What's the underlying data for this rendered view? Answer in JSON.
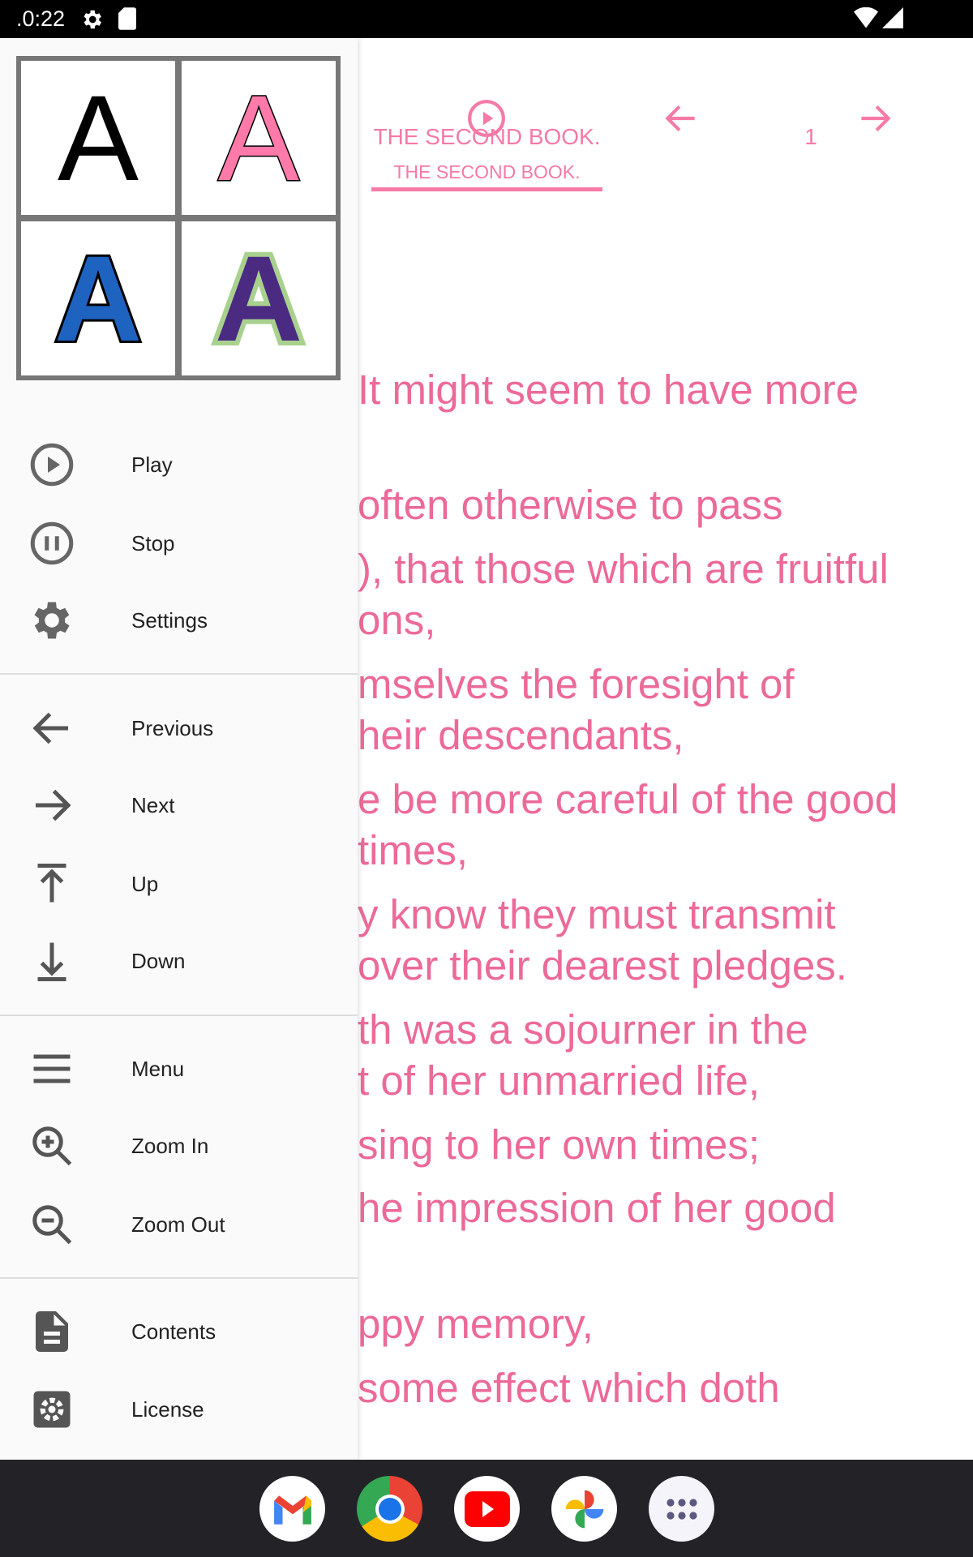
{
  "status_bar": {
    "time": ".0:22",
    "icons": [
      "settings-icon",
      "sd-card-icon",
      "wifi-icon",
      "signal-icon"
    ]
  },
  "header": {
    "tab_title": "THE SECOND BOOK.",
    "tab_subtitle": "THE SECOND BOOK.",
    "page_number": "1",
    "icons": [
      "play-circle-icon",
      "arrow-left-icon",
      "arrow-right-icon"
    ]
  },
  "accent_color": "#f57aa5",
  "text_color": "#ec6a98",
  "body_lines": [
    "It might seem to have more",
    " often otherwise to pass",
    "), that those which are fruitful",
    "ons,",
    "mselves the foresight of",
    "heir descendants,",
    "e be more careful of the good",
    " times,",
    "y know they must transmit",
    "over their dearest pledges.",
    "th was a sojourner in the",
    "t of her unmarried life,",
    "sing to her own times;",
    "he impression of her good",
    "ppy memory,",
    "some effect which doth"
  ],
  "font_tiles": [
    {
      "letter": "A",
      "fill": "#000000",
      "outline": "#000000"
    },
    {
      "letter": "A",
      "fill": "#ff7aa8",
      "outline": "#000000"
    },
    {
      "letter": "A",
      "fill": "#1e63c0",
      "outline": "#000000"
    },
    {
      "letter": "A",
      "fill": "#4b2a82",
      "outline": "#a9d18e"
    }
  ],
  "drawer": {
    "items": [
      {
        "label": "Play",
        "icon": "play-circle-icon"
      },
      {
        "label": "Stop",
        "icon": "pause-circle-icon"
      },
      {
        "label": "Settings",
        "icon": "gear-icon"
      },
      {
        "label": "Previous",
        "icon": "arrow-left-icon"
      },
      {
        "label": "Next",
        "icon": "arrow-right-icon"
      },
      {
        "label": "Up",
        "icon": "arrow-up-to-top-icon"
      },
      {
        "label": "Down",
        "icon": "arrow-down-to-bottom-icon"
      },
      {
        "label": "Menu",
        "icon": "hamburger-icon"
      },
      {
        "label": "Zoom In",
        "icon": "zoom-in-icon"
      },
      {
        "label": "Zoom Out",
        "icon": "zoom-out-icon"
      },
      {
        "label": "Contents",
        "icon": "document-icon"
      },
      {
        "label": "License",
        "icon": "gear-square-icon"
      }
    ]
  },
  "dock": [
    "gmail-icon",
    "chrome-icon",
    "youtube-icon",
    "photos-icon",
    "app-drawer-icon"
  ]
}
